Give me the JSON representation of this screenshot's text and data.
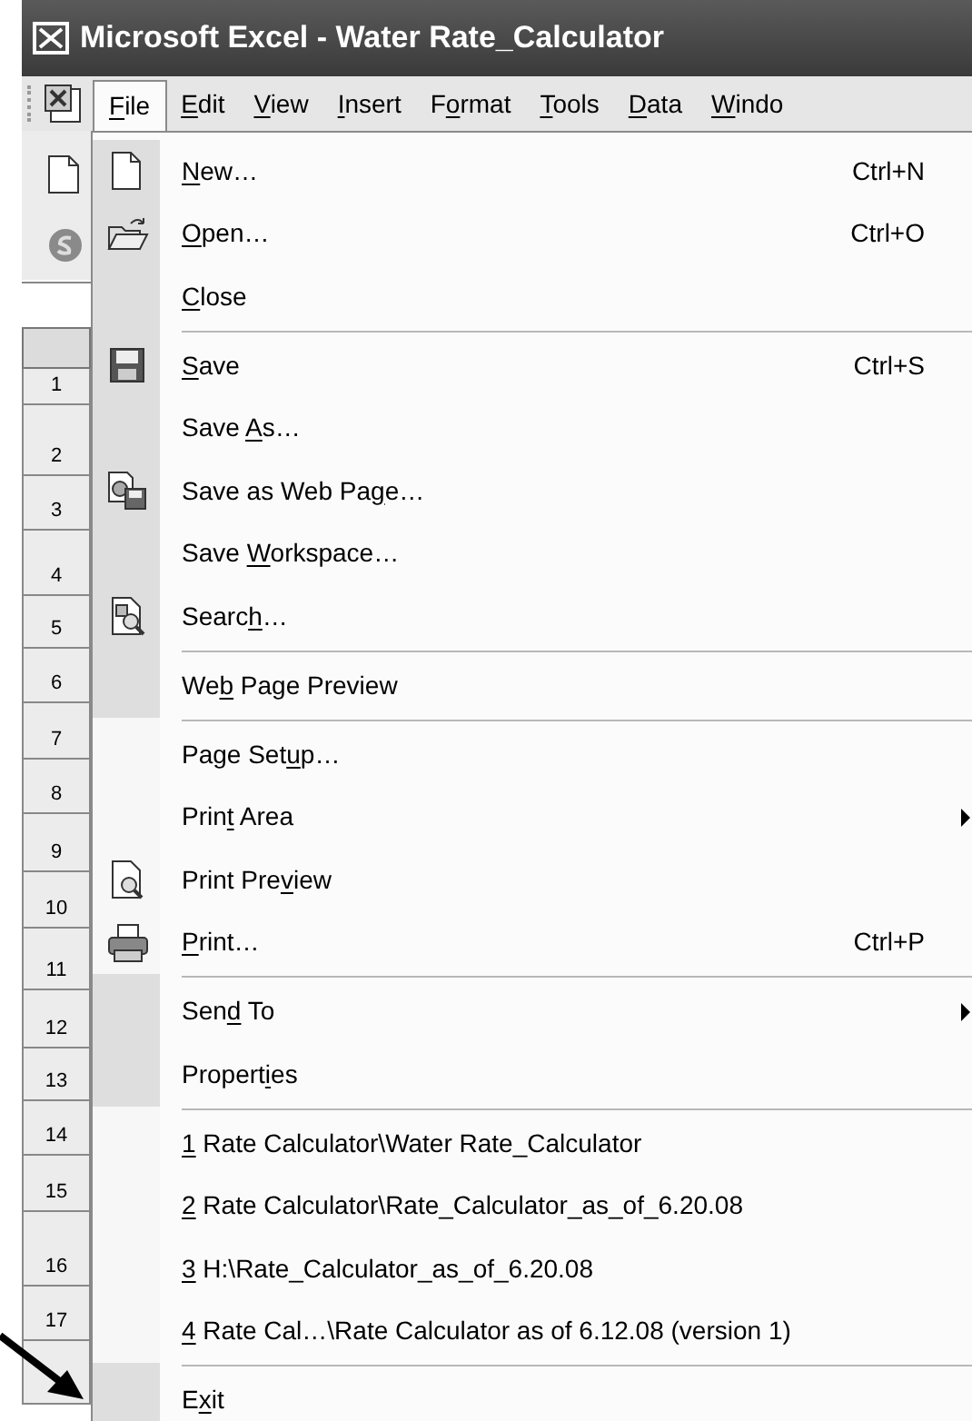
{
  "window": {
    "title": "Microsoft Excel - Water Rate_Calculator"
  },
  "menu_bar": [
    {
      "key": "F",
      "post": "ile",
      "selected": true
    },
    {
      "key": "E",
      "post": "dit",
      "selected": false
    },
    {
      "key": "V",
      "post": "iew",
      "selected": false
    },
    {
      "key": "I",
      "post": "nsert",
      "selected": false
    },
    {
      "pre": "F",
      "key": "o",
      "post": "rmat",
      "selected": false
    },
    {
      "key": "T",
      "post": "ools",
      "selected": false
    },
    {
      "key": "D",
      "post": "ata",
      "selected": false
    },
    {
      "key": "W",
      "post": "indo",
      "selected": false
    }
  ],
  "row_headers": [
    "1",
    "2",
    "3",
    "4",
    "5",
    "6",
    "7",
    "8",
    "9",
    "10",
    "11",
    "12",
    "13",
    "14",
    "15",
    "16",
    "17"
  ],
  "file_menu": [
    {
      "kind": "item",
      "key": "N",
      "post": "ew…",
      "shortcut": "Ctrl+N",
      "rarely_used": false
    },
    {
      "kind": "item",
      "key": "O",
      "post": "pen…",
      "shortcut": "Ctrl+O",
      "rarely_used": false
    },
    {
      "kind": "item",
      "key": "C",
      "post": "lose",
      "rarely_used": false
    },
    {
      "kind": "separator"
    },
    {
      "kind": "item",
      "key": "S",
      "post": "ave",
      "shortcut": "Ctrl+S",
      "rarely_used": false
    },
    {
      "kind": "item",
      "pre": "Save ",
      "key": "A",
      "post": "s…",
      "rarely_used": false
    },
    {
      "kind": "item",
      "pre": "Save as Web Pa",
      "key": "g",
      "post": "e…",
      "rarely_used": false
    },
    {
      "kind": "item",
      "pre": "Save ",
      "key": "W",
      "post": "orkspace…",
      "rarely_used": false
    },
    {
      "kind": "item",
      "pre": "Searc",
      "key": "h",
      "post": "…",
      "rarely_used": false
    },
    {
      "kind": "separator"
    },
    {
      "kind": "item",
      "pre": "We",
      "key": "b",
      "post": " Page Preview",
      "rarely_used": false
    },
    {
      "kind": "separator"
    },
    {
      "kind": "item",
      "pre": "Page Set",
      "key": "u",
      "post": "p…",
      "rarely_used": true
    },
    {
      "kind": "item",
      "pre": "Prin",
      "key": "t",
      "post": " Area",
      "submenu": true,
      "rarely_used": true
    },
    {
      "kind": "item",
      "pre": "Print Pre",
      "key": "v",
      "post": "iew",
      "rarely_used": true
    },
    {
      "kind": "item",
      "key": "P",
      "post": "rint…",
      "shortcut": "Ctrl+P",
      "rarely_used": true
    },
    {
      "kind": "separator"
    },
    {
      "kind": "item",
      "pre": "Sen",
      "key": "d",
      "post": " To",
      "submenu": true,
      "rarely_used": false
    },
    {
      "kind": "item",
      "pre": "Propert",
      "key": "i",
      "post": "es",
      "rarely_used": false
    },
    {
      "kind": "separator"
    },
    {
      "kind": "item",
      "key": "1",
      "post": " Rate Calculator\\Water Rate_Calculator",
      "rarely_used": true
    },
    {
      "kind": "item",
      "key": "2",
      "post": " Rate Calculator\\Rate_Calculator_as_of_6.20.08",
      "rarely_used": true
    },
    {
      "kind": "item",
      "key": "3",
      "post": " H:\\Rate_Calculator_as_of_6.20.08",
      "rarely_used": true
    },
    {
      "kind": "item",
      "key": "4",
      "post": " Rate Cal…\\Rate Calculator as of 6.12.08 (version 1)",
      "rarely_used": true
    },
    {
      "kind": "separator"
    },
    {
      "kind": "item",
      "pre": "E",
      "key": "x",
      "post": "it",
      "rarely_used": false
    }
  ]
}
